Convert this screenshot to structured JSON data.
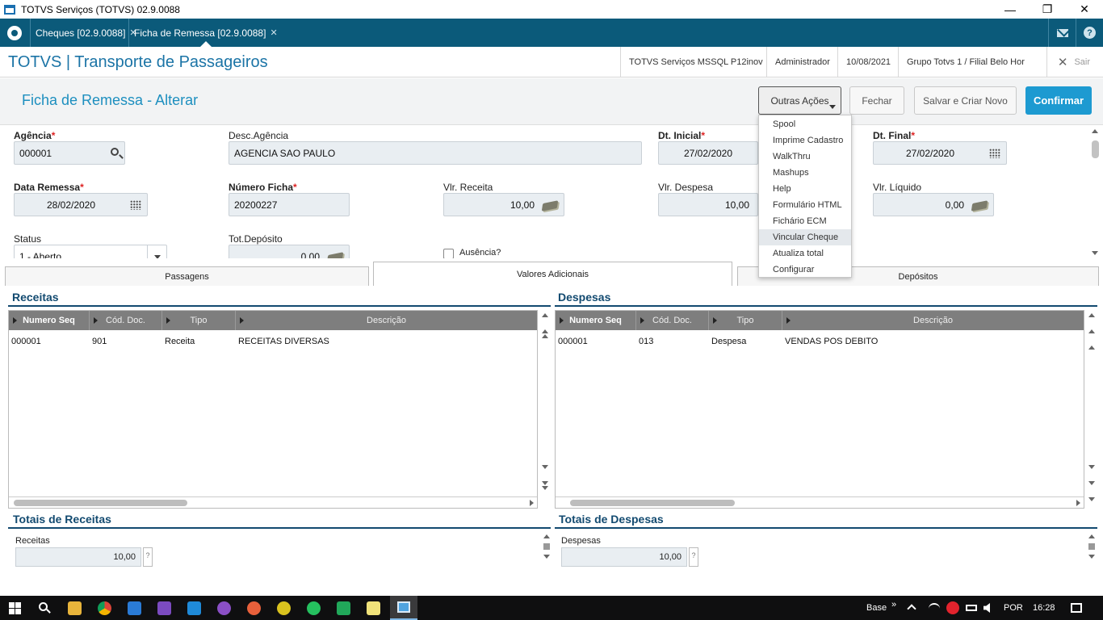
{
  "window": {
    "title": "TOTVS Serviços (TOTVS) 02.9.0088",
    "minimize": "—",
    "restore": "❐",
    "close": "✕"
  },
  "tabs": [
    {
      "label": "Cheques [02.9.0088]",
      "close": "✕"
    },
    {
      "label": "Ficha de Remessa [02.9.0088]",
      "close": "✕"
    }
  ],
  "header": {
    "brand": "TOTVS | Transporte de Passageiros",
    "server": "TOTVS Serviços MSSQL P12inov",
    "user": "Administrador",
    "date": "10/08/2021",
    "branch": "Grupo Totvs 1 / Filial Belo Hor",
    "exit_icon": "✕",
    "exit": "Sair"
  },
  "form": {
    "title": "Ficha de Remessa - Alterar",
    "buttons": {
      "outras": "Outras Ações",
      "fechar": "Fechar",
      "salvar": "Salvar e Criar Novo",
      "confirmar": "Confirmar"
    }
  },
  "fields": {
    "agencia": {
      "label": "Agência",
      "required": "*",
      "value": "000001"
    },
    "desc_agencia": {
      "label": "Desc.Agência",
      "value": "AGENCIA SAO PAULO"
    },
    "dt_inicial": {
      "label": "Dt. Inicial",
      "required": "*",
      "value": "27/02/2020"
    },
    "dt_final": {
      "label": "Dt. Final",
      "required": "*",
      "value": "27/02/2020"
    },
    "data_remessa": {
      "label": "Data Remessa",
      "required": "*",
      "value": "28/02/2020"
    },
    "numero_ficha": {
      "label": "Número Ficha",
      "required": "*",
      "value": "20200227"
    },
    "vlr_receita": {
      "label": "Vlr. Receita",
      "value": "10,00"
    },
    "vlr_despesa": {
      "label": "Vlr. Despesa",
      "value": "10,00"
    },
    "vlr_liquido": {
      "label": "Vlr. Líquido",
      "value": "0,00"
    },
    "status": {
      "label": "Status",
      "value": "1 - Aberto"
    },
    "tot_deposito": {
      "label": "Tot.Depósito",
      "value": "0,00"
    },
    "ausencia": {
      "label": "Ausência?"
    }
  },
  "folder_tabs": [
    "Passagens",
    "Valores Adicionais",
    "Depósitos"
  ],
  "receitas": {
    "title": "Receitas",
    "columns": [
      "Numero Seq",
      "Cód. Doc.",
      "Tipo",
      "Descrição"
    ],
    "rows": [
      [
        "000001",
        "901",
        "Receita",
        "RECEITAS DIVERSAS"
      ]
    ],
    "totals_title": "Totais de Receitas",
    "total_label": "Receitas",
    "total_value": "10,00",
    "help": "?"
  },
  "despesas": {
    "title": "Despesas",
    "columns": [
      "Numero Seq",
      "Cód. Doc.",
      "Tipo",
      "Descrição"
    ],
    "rows": [
      [
        "000001",
        "013",
        "Despesa",
        "VENDAS POS DEBITO"
      ]
    ],
    "totals_title": "Totais de Despesas",
    "total_label": "Despesas",
    "total_value": "10,00",
    "help": "?"
  },
  "menu": {
    "items": [
      "Spool",
      "Imprime Cadastro",
      "WalkThru",
      "Mashups",
      "Help",
      "Formulário HTML",
      "Fichário ECM",
      "Vincular Cheque",
      "Atualiza total",
      "Configurar"
    ],
    "hovered": "Vincular Cheque"
  },
  "taskbar": {
    "base": "Base",
    "chevron": "»",
    "lang": "POR",
    "time": "16:28"
  },
  "colors": {
    "brand_blue": "#1b74a6",
    "tabs_bar": "#0b5a7a",
    "confirm_button": "#1d9ad1",
    "section_title": "#124a70"
  }
}
